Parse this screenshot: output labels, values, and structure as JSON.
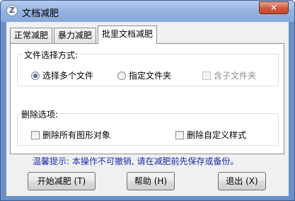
{
  "window": {
    "title": "文档减肥",
    "close_label": "✕"
  },
  "tabs": [
    "正常减肥",
    "暴力减肥",
    "批里文档减肥"
  ],
  "file_mode": {
    "legend": "文件选择方式:",
    "options": [
      "选择多个文件",
      "指定文件夹"
    ],
    "selected": "选择多个文件",
    "subfolder_label": "含子文件夹",
    "subfolder_enabled": false
  },
  "delete_options": {
    "legend": "删除选项:",
    "items": [
      "删除所有图形对象",
      "删除自定义样式"
    ]
  },
  "hint": "温馨提示: 本操作不可撤销, 请在减肥前先保存或备份。",
  "buttons": {
    "start": "开始减肥 (T)",
    "help": "帮助 (H)",
    "exit": "退出 (X)"
  },
  "colors": {
    "title_bar": "#94b2e0",
    "close_button": "#d2573a",
    "hint_text": "#1a2ab0"
  },
  "icons": {
    "app": "app-logo-icon",
    "close": "close-icon"
  }
}
